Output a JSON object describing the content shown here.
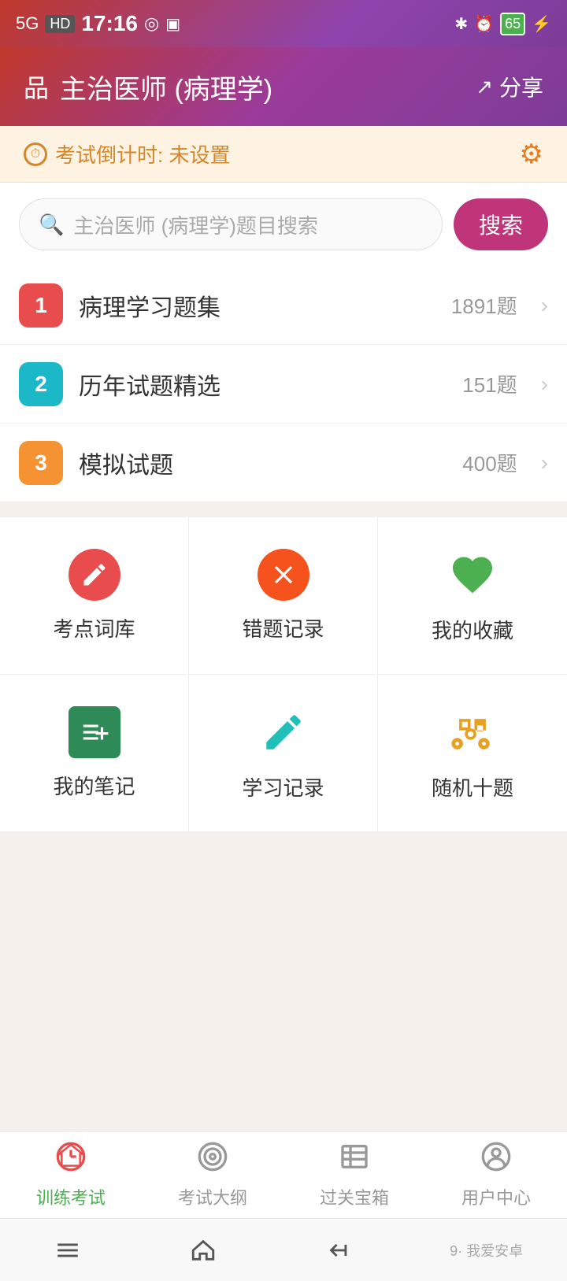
{
  "statusBar": {
    "signal": "5G",
    "hd": "HD",
    "time": "17:16",
    "bluetooth": "⚡",
    "battery": "65"
  },
  "header": {
    "icon": "品",
    "title": "主治医师 (病理学)",
    "shareLabel": "分享"
  },
  "countdown": {
    "label": "考试倒计时: 未设置"
  },
  "search": {
    "placeholder": "主治医师 (病理学)题目搜索",
    "buttonLabel": "搜索"
  },
  "listItems": [
    {
      "num": "1",
      "label": "病理学习题集",
      "count": "1891题",
      "colorClass": "num-red"
    },
    {
      "num": "2",
      "label": "历年试题精选",
      "count": "151题",
      "colorClass": "num-cyan"
    },
    {
      "num": "3",
      "label": "模拟试题",
      "count": "400题",
      "colorClass": "num-orange"
    }
  ],
  "gridItems": [
    {
      "id": "kaodian",
      "label": "考点词库",
      "iconType": "pencil"
    },
    {
      "id": "cuoti",
      "label": "错题记录",
      "iconType": "x-circle"
    },
    {
      "id": "shoucang",
      "label": "我的收藏",
      "iconType": "heart"
    },
    {
      "id": "biji",
      "label": "我的笔记",
      "iconType": "notes"
    },
    {
      "id": "xuexi",
      "label": "学习记录",
      "iconType": "pen"
    },
    {
      "id": "suiji",
      "label": "随机十题",
      "iconType": "binoculars"
    }
  ],
  "bottomNav": [
    {
      "id": "train",
      "label": "训练考试",
      "active": true
    },
    {
      "id": "outline",
      "label": "考试大纲",
      "active": false
    },
    {
      "id": "treasure",
      "label": "过关宝箱",
      "active": false
    },
    {
      "id": "user",
      "label": "用户中心",
      "active": false
    }
  ]
}
